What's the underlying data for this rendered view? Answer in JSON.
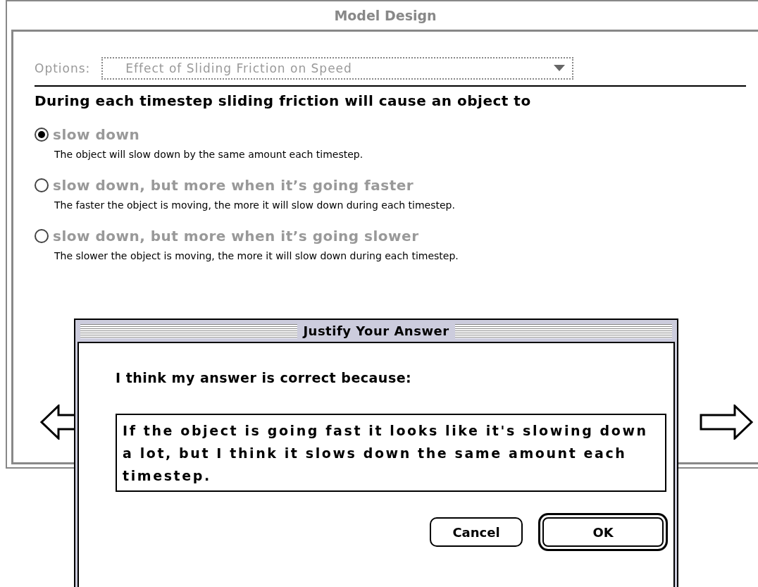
{
  "window": {
    "title": "Model Design"
  },
  "options": {
    "label": "Options:",
    "value": "Effect of Sliding Friction on Speed",
    "disabled": true
  },
  "question": "During each timestep sliding friction will cause an object to",
  "choices": [
    {
      "label": "slow down",
      "description": "The object will slow down by the same amount each timestep.",
      "selected": true,
      "disabled": true
    },
    {
      "label": "slow down, but more when it’s going faster",
      "description": "The faster the object is moving, the more it will slow down during each timestep.",
      "selected": false,
      "disabled": true
    },
    {
      "label": "slow down, but more when it’s going slower",
      "description": "The slower the object is moving, the more it will slow down during each timestep.",
      "selected": false,
      "disabled": true
    }
  ],
  "dialog": {
    "title": "Justify Your Answer",
    "prompt": "I think my answer is correct because:",
    "answer": "If the object is going fast it looks like it's slowing down a lot, but I think it slows down the same amount each timestep.",
    "buttons": [
      {
        "label": "Cancel",
        "default": false
      },
      {
        "label": "OK",
        "default": true
      }
    ]
  }
}
